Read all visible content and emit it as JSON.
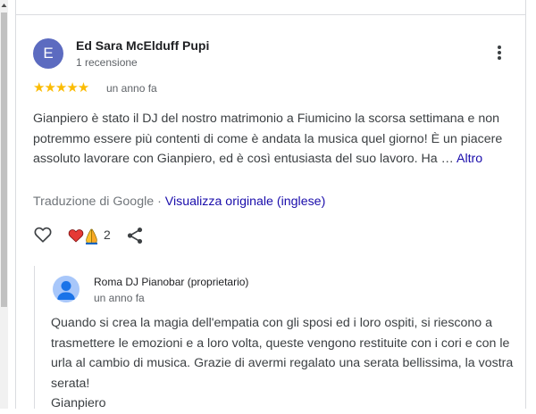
{
  "review": {
    "author_initial": "E",
    "author_name": "Ed Sara McElduff Pupi",
    "author_reviews": "1 recensione",
    "rating": 5,
    "stars_text": "★★★★★",
    "date": "un anno fa",
    "text": "Gianpiero è stato il DJ del nostro matrimonio a Fiumicino la scorsa settimana e non potremmo essere più contenti di come è andata la musica quel giorno! È un piacere assoluto lavorare con Gianpiero, ed è così entusiasta del suo lavoro. Ha …",
    "more_label": "Altro",
    "translation_note": "Traduzione di Google",
    "translation_sep": " · ",
    "view_original": "Visualizza originale (inglese)",
    "reaction_count": "2"
  },
  "owner_reply": {
    "name": "Roma DJ Pianobar (proprietario)",
    "date": "un anno fa",
    "text": "Quando si crea la magia dell'empatia con gli sposi ed i loro ospiti, si riescono a trasmettere le emozioni e a loro volta, queste vengono restituite con i cori e con le urla al cambio di musica. Grazie di avermi regalato una serata bellissima, la vostra serata!",
    "signature": "Gianpiero"
  },
  "colors": {
    "avatar": "#5c6bc0",
    "star": "#fbbc04",
    "link": "#1a0dab"
  },
  "icons": [
    "more-vert-icon",
    "like-icon",
    "heart-icon",
    "praying-hands-icon",
    "share-icon",
    "person-icon"
  ]
}
